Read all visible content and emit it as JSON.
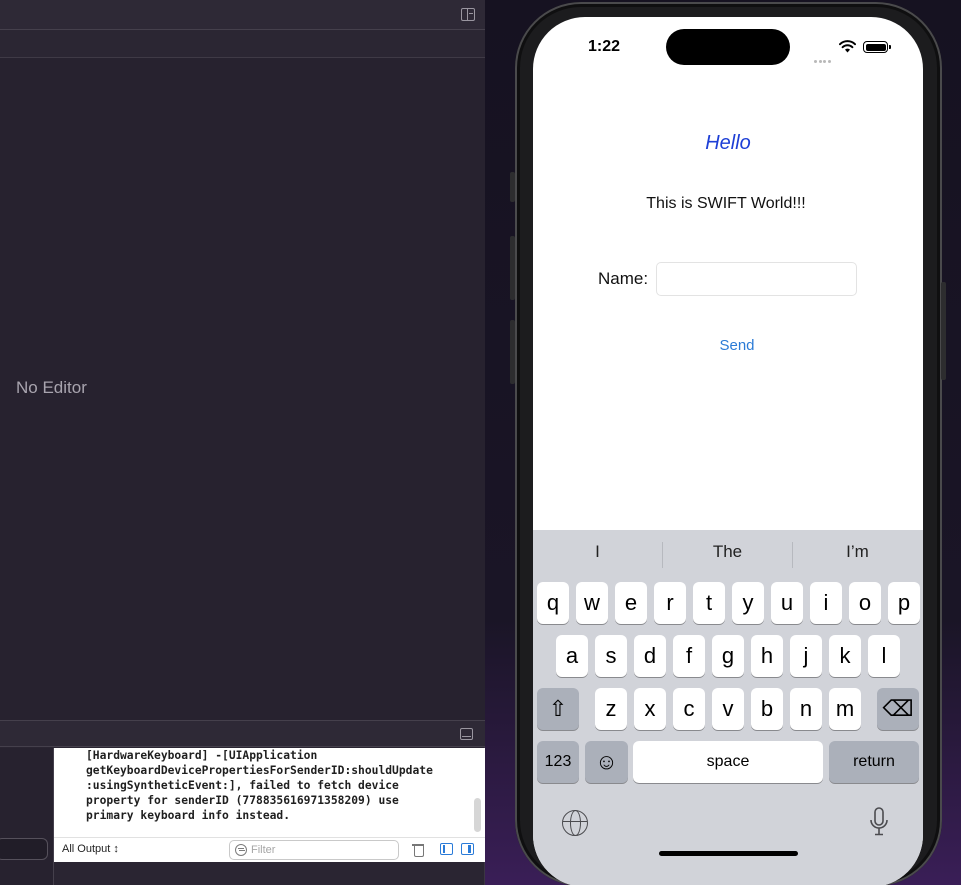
{
  "xcode": {
    "editor_placeholder": "No Editor",
    "console_lines": [
      "[HardwareKeyboard] -[UIApplication",
      "getKeyboardDevicePropertiesForSenderID:shouldUpdate",
      ":usingSyntheticEvent:], failed to fetch device",
      "property for senderID (778835616971358209) use",
      "primary keyboard info instead."
    ],
    "output_selector": "All Output ↕",
    "filter_placeholder": "Filter"
  },
  "phone": {
    "status_time": "1:22",
    "title": "Hello",
    "subtitle": "This is SWIFT World!!!",
    "name_label": "Name:",
    "name_value": "",
    "send_label": "Send"
  },
  "keyboard": {
    "suggestions": [
      "I",
      "The",
      "I’m"
    ],
    "row1": [
      "q",
      "w",
      "e",
      "r",
      "t",
      "y",
      "u",
      "i",
      "o",
      "p"
    ],
    "row2": [
      "a",
      "s",
      "d",
      "f",
      "g",
      "h",
      "j",
      "k",
      "l"
    ],
    "row3": [
      "z",
      "x",
      "c",
      "v",
      "b",
      "n",
      "m"
    ],
    "shift_symbol": "⇧",
    "delete_symbol": "⌫",
    "numbers_label": "123",
    "emoji_symbol": "☺",
    "space_label": "space",
    "return_label": "return"
  }
}
